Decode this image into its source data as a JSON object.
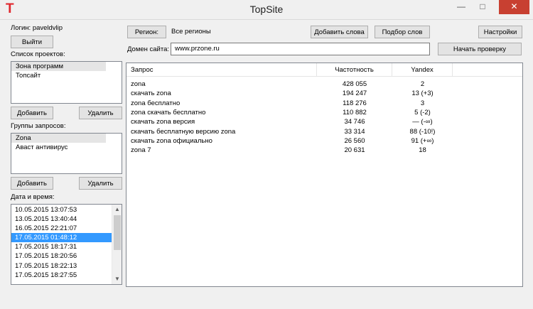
{
  "window": {
    "title": "TopSite",
    "icon": "T"
  },
  "login": {
    "label": "Логин: paveldvlip",
    "logout_label": "Выйти"
  },
  "projects": {
    "title": "Список проектов:",
    "items": [
      {
        "label": "Зона программ",
        "selected": true
      },
      {
        "label": "Топсайт",
        "selected": false
      }
    ],
    "add_label": "Добавить",
    "delete_label": "Удалить"
  },
  "groups": {
    "title": "Группы запросов:",
    "items": [
      {
        "label": "Zona",
        "selected": true
      },
      {
        "label": "Аваст антивирус",
        "selected": false
      }
    ],
    "add_label": "Добавить",
    "delete_label": "Удалить"
  },
  "datetime": {
    "title": "Дата и время:",
    "items": [
      {
        "label": "10.05.2015 13:07:53",
        "active": false
      },
      {
        "label": "13.05.2015 13:40:44",
        "active": false
      },
      {
        "label": "16.05.2015 22:21:07",
        "active": false
      },
      {
        "label": "17.05.2015 01:48:12",
        "active": true
      },
      {
        "label": "17.05.2015 18:17:31",
        "active": false
      },
      {
        "label": "17.05.2015 18:20:56",
        "active": false
      },
      {
        "label": "17.05.2015 18:22:13",
        "active": false
      },
      {
        "label": "17.05.2015 18:27:55",
        "active": false
      }
    ]
  },
  "toolbar": {
    "region_button": "Регион:",
    "region_value": "Все регионы",
    "add_words": "Добавить слова",
    "select_words": "Подбор слов",
    "settings": "Настройки",
    "domain_label": "Домен сайта:",
    "domain_value": "www.przone.ru",
    "start_check": "Начать проверку"
  },
  "table": {
    "columns": [
      "Запрос",
      "Частотность",
      "Yandex"
    ],
    "rows": [
      {
        "query": "zona",
        "freq": "428 055",
        "yandex": "2"
      },
      {
        "query": "скачать zona",
        "freq": "194 247",
        "yandex": "13 (+3)"
      },
      {
        "query": "zona бесплатно",
        "freq": "118 276",
        "yandex": "3"
      },
      {
        "query": "zona скачать бесплатно",
        "freq": "110 882",
        "yandex": "5 (-2)"
      },
      {
        "query": "скачать zona версия",
        "freq": "34 746",
        "yandex": "— (-∞)"
      },
      {
        "query": "скачать бесплатную версию zona",
        "freq": "33 314",
        "yandex": "88 (-10!)"
      },
      {
        "query": "скачать zona официально",
        "freq": "26 560",
        "yandex": "91 (+∞)"
      },
      {
        "query": "zona 7",
        "freq": "20 631",
        "yandex": "18"
      }
    ]
  },
  "colors": {
    "accent": "#3399ff",
    "close_button": "#c84031",
    "logo": "#e0282e"
  }
}
